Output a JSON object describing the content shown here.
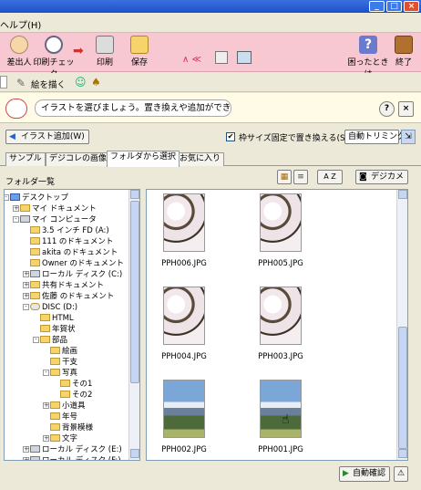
{
  "titlebar": {
    "buttons": [
      "_",
      "□",
      "×"
    ]
  },
  "menubar": {
    "help": "ヘルプ(H)"
  },
  "toolbar": {
    "items": [
      {
        "label": "差出人",
        "icon": "person-icon"
      },
      {
        "label": "印刷チェック",
        "icon": "magnifier-icon"
      },
      {
        "label": "印刷",
        "icon": "printer-icon"
      },
      {
        "label": "保存",
        "icon": "folder-icon"
      },
      {
        "label": "困ったときは",
        "icon": "help-icon"
      },
      {
        "label": "終了",
        "icon": "exit-door-icon"
      }
    ],
    "mid_icons": "∧ ≪"
  },
  "tool2": {
    "draw_label": "絵を描く"
  },
  "message": {
    "text": "イラストを選びましょう。置き換えや追加ができます。",
    "help": "?",
    "close": "×"
  },
  "options": {
    "add_illust": "イラスト追加(W)",
    "checkbox_label": "枠サイズ固定で置き換える(S)",
    "checked": true,
    "trim_select": "自動トリミング"
  },
  "tabs": [
    "サンプル",
    "デジコレの画像",
    "フォルダから選択",
    "お気に入り"
  ],
  "active_tab": 2,
  "tree": {
    "label": "フォルダ一覧",
    "nodes": [
      {
        "label": "デスクトップ",
        "indent": 0
      },
      {
        "label": "マイ ドキュメント",
        "indent": 1
      },
      {
        "label": "マイ コンピュータ",
        "indent": 1
      },
      {
        "label": "3.5 インチ FD (A:)",
        "indent": 2
      },
      {
        "label": "111 のドキュメント",
        "indent": 2
      },
      {
        "label": "akita のドキュメント",
        "indent": 2
      },
      {
        "label": "Owner のドキュメント",
        "indent": 2
      },
      {
        "label": "ローカル ディスク (C:)",
        "indent": 2
      },
      {
        "label": "共有ドキュメント",
        "indent": 2
      },
      {
        "label": "佐藤 のドキュメント",
        "indent": 2
      },
      {
        "label": "DISC (D:)",
        "indent": 2
      },
      {
        "label": "HTML",
        "indent": 3
      },
      {
        "label": "年賀状",
        "indent": 3
      },
      {
        "label": "部品",
        "indent": 3
      },
      {
        "label": "絵画",
        "indent": 4
      },
      {
        "label": "干支",
        "indent": 4
      },
      {
        "label": "写真",
        "indent": 4
      },
      {
        "label": "その1",
        "indent": 5
      },
      {
        "label": "その2",
        "indent": 5
      },
      {
        "label": "小道具",
        "indent": 4
      },
      {
        "label": "年号",
        "indent": 4
      },
      {
        "label": "背景模様",
        "indent": 4
      },
      {
        "label": "文字",
        "indent": 4
      },
      {
        "label": "ローカル ディスク (E:)",
        "indent": 2
      },
      {
        "label": "ローカル ディスク (F:)",
        "indent": 2
      }
    ]
  },
  "viewbar": {
    "sort": "A Z",
    "camera": "デジカメ"
  },
  "images": [
    {
      "name": "PPH006.JPG",
      "kind": "blossom"
    },
    {
      "name": "PPH005.JPG",
      "kind": "blossom"
    },
    {
      "name": "PPH004.JPG",
      "kind": "blossom"
    },
    {
      "name": "PPH003.JPG",
      "kind": "blossom"
    },
    {
      "name": "PPH002.JPG",
      "kind": "fuji"
    },
    {
      "name": "PPH001.JPG",
      "kind": "fuji"
    }
  ],
  "status": {
    "confirm": "自動確認"
  },
  "colors": {
    "toolbar_bg": "#f7c8d2",
    "accent": "#1d50c8"
  }
}
